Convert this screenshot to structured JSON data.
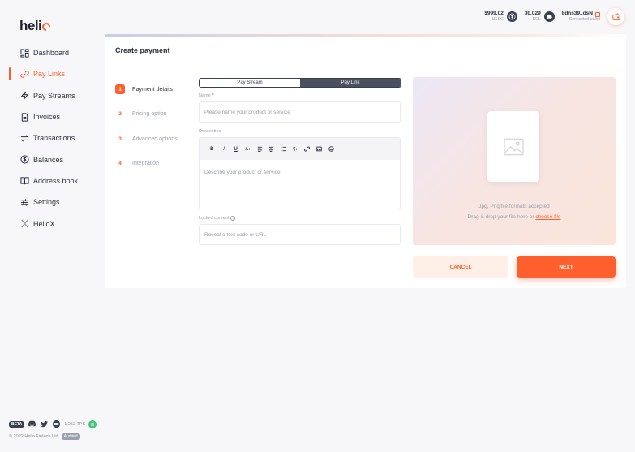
{
  "brand": {
    "logo_text": "heli",
    "accent": "#fe5f2c"
  },
  "sidebar": {
    "items": [
      {
        "label": "Dashboard",
        "icon": "dashboard-icon"
      },
      {
        "label": "Pay Links",
        "icon": "link-icon",
        "active": true
      },
      {
        "label": "Pay Streams",
        "icon": "lightning-icon"
      },
      {
        "label": "Invoices",
        "icon": "document-icon"
      },
      {
        "label": "Transactions",
        "icon": "arrows-icon"
      },
      {
        "label": "Balances",
        "icon": "dollar-icon"
      },
      {
        "label": "Address book",
        "icon": "book-icon"
      },
      {
        "label": "Settings",
        "icon": "sliders-icon"
      },
      {
        "label": "HelioX",
        "icon": "x-icon"
      }
    ]
  },
  "footer": {
    "beta": "BETA",
    "tps": "1,252 TPS",
    "copyright": "© 2022 Helio Fintech Ltd",
    "audited": "Audited"
  },
  "topbar": {
    "usdc_amount": "$999.02",
    "usdc_label": "USDC",
    "sol_amount": "30.029",
    "sol_label": "SOL",
    "wallet_address": "8dns39..dsN",
    "wallet_status": "Connected wallet"
  },
  "form": {
    "title": "Create payment",
    "steps": [
      {
        "num": "1",
        "label": "Payment details",
        "active": true
      },
      {
        "num": "2",
        "label": "Pricing option"
      },
      {
        "num": "3",
        "label": "Advanced options"
      },
      {
        "num": "4",
        "label": "Integration"
      }
    ],
    "toggle": {
      "left": "Pay Stream",
      "right": "Pay Link"
    },
    "name_label": "Name",
    "name_required": "*",
    "name_placeholder": "Please name your product or service",
    "description_label": "Description",
    "description_placeholder": "Describe your product or service",
    "locked_label": "Locked content",
    "locked_placeholder": "Reveal a text code or URL",
    "dropzone_formats": "Jpg, Png file formats accepted",
    "dropzone_prompt": "Drag & drop your file here or",
    "dropzone_link": "choose file",
    "cancel_label": "CANCEL",
    "next_label": "NEXT"
  }
}
